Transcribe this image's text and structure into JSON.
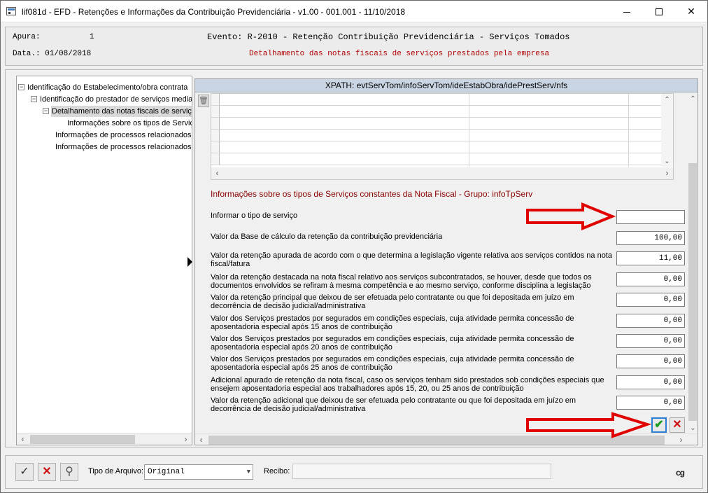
{
  "window": {
    "title": "lif081d - EFD - Retenções e Informações da Contribuição Previdenciária - v1.00 - 001.001 - 11/10/2018"
  },
  "header": {
    "apura_label": "Apura:",
    "apura_value": "1",
    "data_label": "Data.: 01/08/2018",
    "evento": "Evento: R-2010 - Retenção Contribuição Previdenciária - Serviços Tomados",
    "subtitle": "Detalhamento das notas fiscais de serviços prestados pela empresa"
  },
  "tree": {
    "items": [
      {
        "label": "Identificação do Estabelecimento/obra contrata",
        "expander": "−"
      },
      {
        "label": "Identificação do prestador de serviços media",
        "expander": "−"
      },
      {
        "label": "Detalhamento das notas fiscais de serviç",
        "expander": "−"
      },
      {
        "label": "Informações sobre os tipos de Serviço",
        "expander": ""
      },
      {
        "label": "Informações de processos relacionados a",
        "expander": ""
      },
      {
        "label": "Informações de processos relacionados a",
        "expander": ""
      }
    ]
  },
  "panel": {
    "xpath": "XPATH: evtServTom/infoServTom/ideEstabObra/idePrestServ/nfs",
    "section_title": "Informações sobre os tipos de Serviços constantes da Nota Fiscal - Grupo: infoTpServ",
    "fields": [
      {
        "label": "Informar o tipo de serviço",
        "value": ""
      },
      {
        "label": "Valor da Base de cálculo da retenção da contribuição previdenciária",
        "value": "100,00"
      },
      {
        "label": "Valor da retenção apurada de acordo com o que determina a legislação vigente relativa aos serviços contidos na nota fiscal/fatura",
        "value": "11,00"
      },
      {
        "label": "Valor da retenção destacada na nota fiscal relativo aos serviços subcontratados, se houver, desde que todos os documentos envolvidos se refiram à mesma competência e ao mesmo serviço, conforme disciplina a legislação",
        "value": "0,00"
      },
      {
        "label": "Valor da retenção principal que deixou de ser efetuada pelo contratante ou que foi depositada em juízo em decorrência de decisão judicial/administrativa",
        "value": "0,00"
      },
      {
        "label": "Valor dos Serviços prestados por segurados em condições especiais, cuja atividade permita concessão de aposentadoria especial após 15 anos de contribuição",
        "value": "0,00"
      },
      {
        "label": "Valor dos Serviços prestados por segurados em condições especiais, cuja atividade permita concessão de aposentadoria especial após 20 anos de contribuição",
        "value": "0,00"
      },
      {
        "label": "Valor dos Serviços prestados por segurados em condições especiais, cuja atividade permita concessão de aposentadoria especial após 25 anos de contribuição",
        "value": "0,00"
      },
      {
        "label": "Adicional apurado de retenção da nota fiscal, caso os serviços tenham sido prestados sob condições especiais que ensejem aposentadoria especial aos trabalhadores após 15, 20, ou 25 anos de contribuição",
        "value": "0,00"
      },
      {
        "label": "Valor da retenção adicional que deixou de ser efetuada pelo contratante ou que foi depositada em juízo em decorrência de decisão judicial/administrativa",
        "value": "0,00"
      }
    ],
    "ok_icon": "check-icon",
    "cancel_icon": "x-icon"
  },
  "bottom": {
    "tipo_label": "Tipo de Arquivo:",
    "tipo_value": "Original",
    "recibo_label": "Recibo:",
    "recibo_value": "",
    "logo": "cg"
  },
  "colors": {
    "annotation_arrow": "#e00000",
    "xpath_bar": "#c9d5e3",
    "section_title": "#8b0000"
  }
}
